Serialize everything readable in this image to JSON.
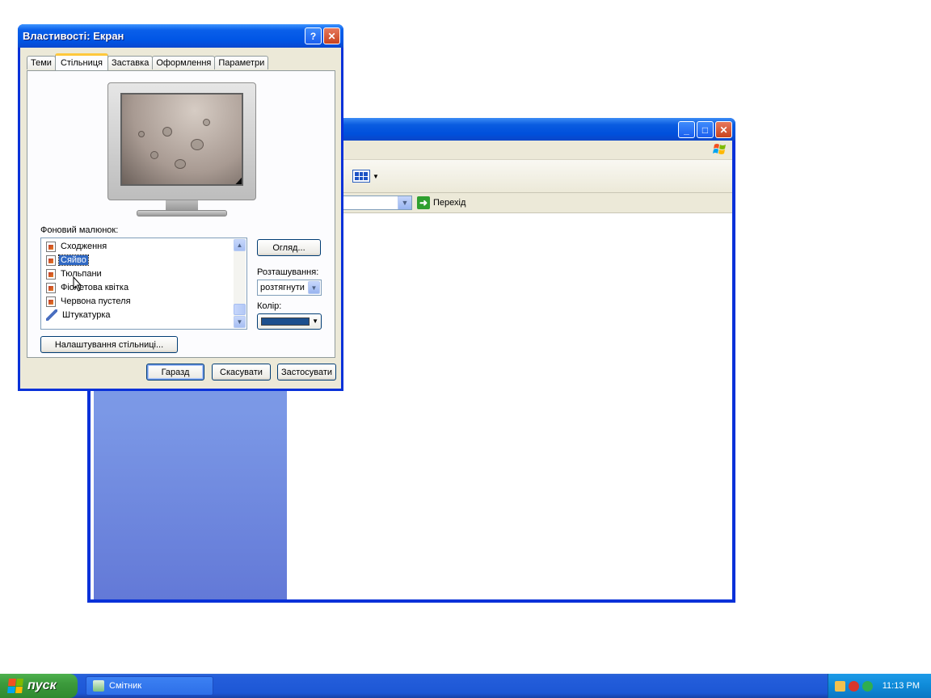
{
  "dialog": {
    "title": "Властивості: Екран",
    "help_label": "?",
    "close_label": "✕",
    "tabs": [
      {
        "label": "Теми",
        "active": false
      },
      {
        "label": "Стільниця",
        "active": true
      },
      {
        "label": "Заставка",
        "active": false
      },
      {
        "label": "Оформлення",
        "active": false
      },
      {
        "label": "Параметри",
        "active": false
      }
    ],
    "background_label": "Фоновий малюнок:",
    "wallpapers": [
      {
        "label": "Сходження",
        "icon": "image-file-icon",
        "selected": false
      },
      {
        "label": "Сяйво",
        "icon": "image-file-icon",
        "selected": true
      },
      {
        "label": "Тюльпани",
        "icon": "image-file-icon",
        "selected": false
      },
      {
        "label": "Фіолетова квітка",
        "icon": "image-file-icon",
        "selected": false
      },
      {
        "label": "Червона пустеля",
        "icon": "image-file-icon",
        "selected": false
      },
      {
        "label": "Штукатурка",
        "icon": "brush-icon",
        "selected": false
      }
    ],
    "browse_label": "Огляд...",
    "position_label": "Розташування:",
    "position_value": "розтягнути",
    "color_label": "Колір:",
    "color_value": "#1c4f8e",
    "customize_label": "Налаштування стільниці...",
    "ok_label": "Гаразд",
    "cancel_label": "Скасувати",
    "apply_label": "Застосувати"
  },
  "explorer": {
    "minimize_label": "_",
    "maximize_label": "□",
    "close_label": "✕",
    "go_label": "Перехід"
  },
  "taskbar": {
    "start_label": "пуск",
    "task_item_label": "Смітник",
    "clock": "11:13 PM"
  },
  "colors": {
    "xp_blue": "#0831d9",
    "dialog_face": "#ece9d8",
    "selection": "#316ac5",
    "left_pane": "#6b86db"
  }
}
